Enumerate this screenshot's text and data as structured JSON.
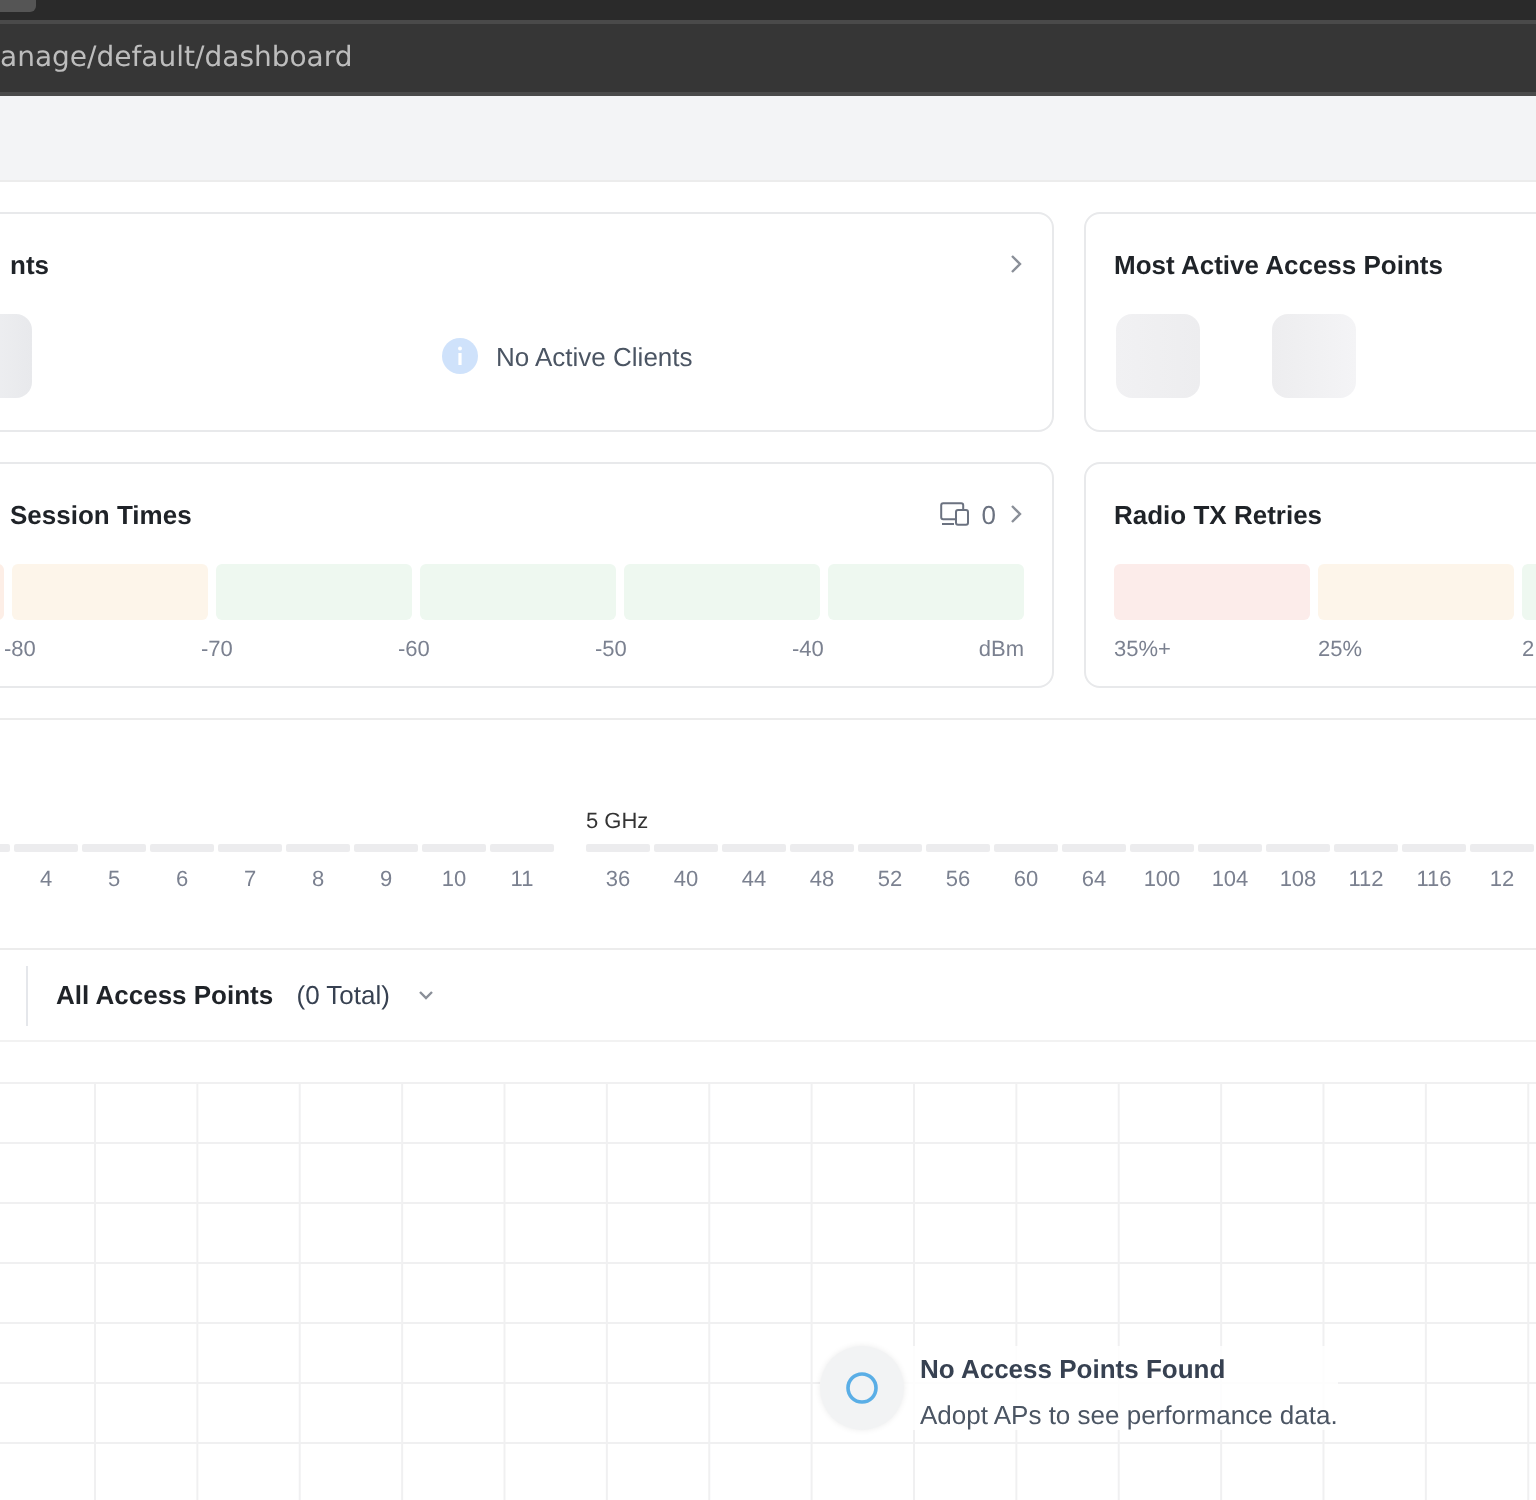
{
  "browser": {
    "url": "anage/default/dashboard"
  },
  "clients_card": {
    "title": "nts",
    "message": "No Active Clients"
  },
  "top_aps_card": {
    "title": "Most Active Access Points"
  },
  "signal_card": {
    "title": "Session Times",
    "device_count": "0",
    "bars": [
      {
        "color": "#fdeee6"
      },
      {
        "color": "#fdf5ea"
      },
      {
        "color": "#eef8f0"
      },
      {
        "color": "#eef8f0"
      },
      {
        "color": "#eef8f0"
      },
      {
        "color": "#eef8f0"
      }
    ],
    "labels": [
      "-80",
      "-70",
      "-60",
      "-50",
      "-40"
    ],
    "unit": "dBm"
  },
  "retries_card": {
    "title": "Radio TX Retries",
    "bars": [
      {
        "color": "#fcecea"
      },
      {
        "color": "#fdf5ea"
      },
      {
        "color": "#eef8f0"
      }
    ],
    "labels": [
      "35%+",
      "25%",
      "2"
    ]
  },
  "channels": {
    "band_24": {
      "channels": [
        "4",
        "5",
        "6",
        "7",
        "8",
        "9",
        "10",
        "11"
      ]
    },
    "band_5": {
      "name": "5 GHz",
      "channels": [
        "36",
        "40",
        "44",
        "48",
        "52",
        "56",
        "60",
        "64",
        "100",
        "104",
        "108",
        "112",
        "116",
        "12"
      ]
    }
  },
  "access_points": {
    "title": "All Access Points",
    "count": "(0 Total)",
    "empty_title": "No Access Points Found",
    "empty_message": "Adopt APs to see performance data."
  }
}
